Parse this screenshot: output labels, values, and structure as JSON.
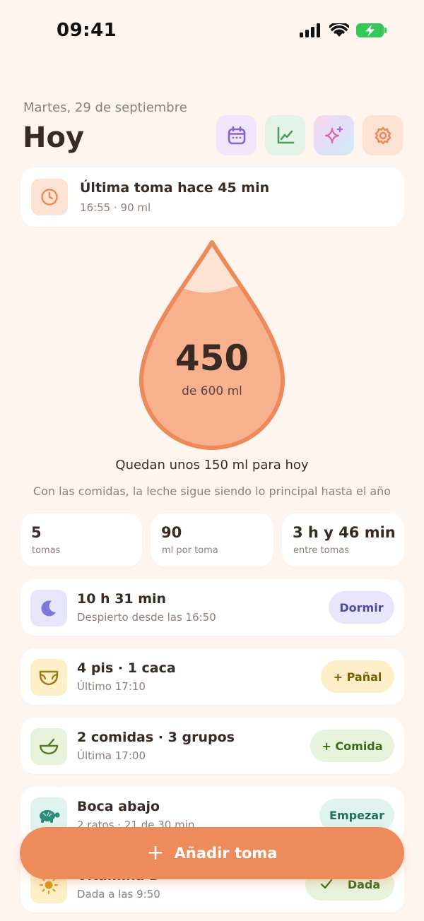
{
  "status_bar": {
    "time": "09:41"
  },
  "header": {
    "date": "Martes, 29 de septiembre",
    "title": "Hoy"
  },
  "top_actions": [
    {
      "icon": "calendar-icon",
      "color": "#8a63d2",
      "bg": "#efe6fb"
    },
    {
      "icon": "chart-icon",
      "color": "#4f9a62",
      "bg": "#e3f3e6"
    },
    {
      "icon": "sparkles-icon",
      "color": "#d86aa0",
      "bg": "#f6dff0"
    },
    {
      "icon": "settings-icon",
      "color": "#ec8a5b",
      "bg": "#fde3d4"
    }
  ],
  "last_feed": {
    "title": "Última toma hace 45 min",
    "subtitle": "16:55 · 90 ml"
  },
  "intake": {
    "value": "450",
    "goal_label": "de 600 ml",
    "fill_fraction": 0.75
  },
  "remaining_text": "Quedan unos 150 ml para hoy",
  "note_text": "Con las comidas, la leche sigue siendo lo principal hasta el año",
  "stats": [
    {
      "value": "5",
      "label": "tomas"
    },
    {
      "value": "90",
      "label": "ml por toma"
    },
    {
      "value": "3 h y 46 min",
      "label": "entre tomas"
    }
  ],
  "sleep": {
    "title": "10 h 31 min",
    "subtitle": "Despierto desde las 16:50",
    "button": "Dormir"
  },
  "diaper": {
    "title": "4 pis · 1 caca",
    "subtitle": "Último 17:10",
    "button": "+ Pañal"
  },
  "food": {
    "title": "2 comidas · 3 grupos",
    "subtitle": "Última 17:00",
    "button": "+ Comida"
  },
  "tummy": {
    "title": "Boca abajo",
    "subtitle": "2 ratos · 21 de 30 min",
    "button": "Empezar"
  },
  "vitamin": {
    "title": "Vitamina D",
    "subtitle": "Dada a las 9:50",
    "button": "Dada"
  },
  "fab": {
    "label": "Añadir toma"
  }
}
